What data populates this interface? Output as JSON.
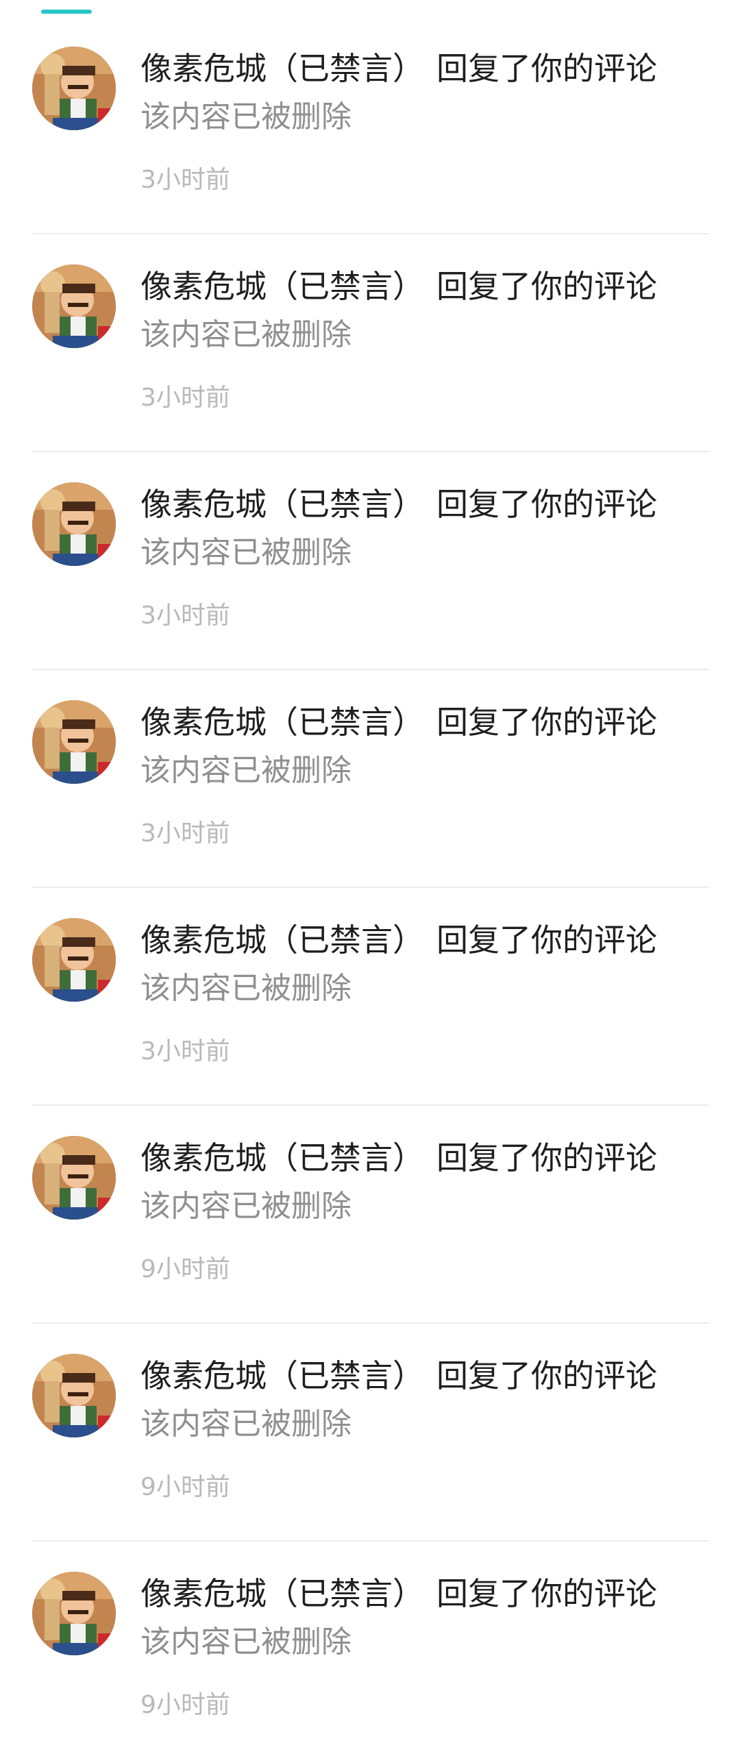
{
  "notifications": [
    {
      "user": "像素危城（已禁言）",
      "action": "回复了你的评论",
      "content": "该内容已被删除",
      "time": "3小时前"
    },
    {
      "user": "像素危城（已禁言）",
      "action": "回复了你的评论",
      "content": "该内容已被删除",
      "time": "3小时前"
    },
    {
      "user": "像素危城（已禁言）",
      "action": "回复了你的评论",
      "content": "该内容已被删除",
      "time": "3小时前"
    },
    {
      "user": "像素危城（已禁言）",
      "action": "回复了你的评论",
      "content": "该内容已被删除",
      "time": "3小时前"
    },
    {
      "user": "像素危城（已禁言）",
      "action": "回复了你的评论",
      "content": "该内容已被删除",
      "time": "3小时前"
    },
    {
      "user": "像素危城（已禁言）",
      "action": "回复了你的评论",
      "content": "该内容已被删除",
      "time": "9小时前"
    },
    {
      "user": "像素危城（已禁言）",
      "action": "回复了你的评论",
      "content": "该内容已被删除",
      "time": "9小时前"
    },
    {
      "user": "像素危城（已禁言）",
      "action": "回复了你的评论",
      "content": "该内容已被删除",
      "time": "9小时前"
    }
  ],
  "colors": {
    "accent": "#26c6c9",
    "primary_text": "#1f1f1f",
    "secondary_text": "#8f8f8f",
    "time_text": "#b9b9b9",
    "divider": "#ececec"
  }
}
